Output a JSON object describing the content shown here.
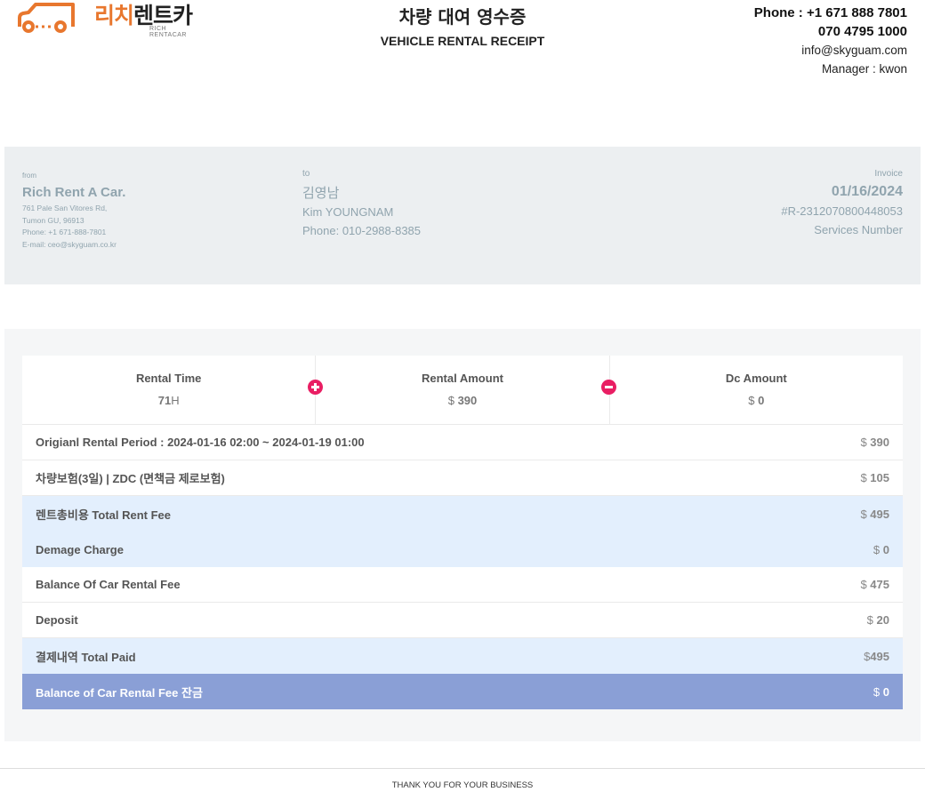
{
  "header": {
    "logo": {
      "korean_part1": "리치",
      "korean_part2": "렌트카",
      "english": "RICH RENTACAR",
      "icon": "car-outline-icon",
      "brand_color": "#e8772e"
    },
    "title_ko": "차량 대여 영수증",
    "title_en": "VEHICLE RENTAL RECEIPT",
    "contact": {
      "phone1": "Phone : +1 671 888 7801",
      "phone2": "070 4795 1000",
      "email": "info@skyguam.com",
      "manager": "Manager : kwon"
    }
  },
  "info": {
    "from": {
      "label": "from",
      "name": "Rich Rent A Car.",
      "address_lines": [
        "761 Pale San Vitores Rd,",
        "Tumon GU, 96913",
        "Phone: +1 671-888-7801",
        "E-mail: ceo@skyguam.co.kr"
      ]
    },
    "to": {
      "label": "to",
      "name_ko": "김영남",
      "name_en": "Kim YOUNGNAM",
      "phone": "Phone: 010-2988-8385"
    },
    "invoice": {
      "label": "Invoice",
      "date": "01/16/2024",
      "number": "#R-2312070800448053",
      "services": "Services Number"
    }
  },
  "summary": {
    "stats": [
      {
        "label": "Rental Time",
        "value": "71",
        "unit": "H"
      },
      {
        "label": "Rental Amount",
        "currency": "$",
        "value": "390"
      },
      {
        "label": "Dc Amount",
        "currency": "$",
        "value": "0"
      }
    ],
    "operators": [
      "plus-circle-icon",
      "minus-circle-icon"
    ],
    "accent_color": "#e91e63",
    "rows": [
      {
        "label": "Origianl Rental Period : 2024-01-16 02:00 ~ 2024-01-19 01:00",
        "currency": "$",
        "amount": "390",
        "style": "white"
      },
      {
        "label": "차량보험(3일) | ZDC (면책금 제로보험)",
        "currency": "$",
        "amount": "105",
        "style": "white"
      },
      {
        "label": "렌트총비용 Total Rent Fee",
        "currency": "$",
        "amount": "495",
        "style": "blue"
      },
      {
        "label": "Demage Charge",
        "currency": "$",
        "amount": "0",
        "style": "blue"
      },
      {
        "label": "Balance Of Car Rental Fee",
        "currency": "$",
        "amount": "475",
        "style": "white"
      },
      {
        "label": "Deposit",
        "currency": "$",
        "amount": "20",
        "style": "white"
      },
      {
        "label": "결제내역 Total Paid",
        "currency": "$",
        "amount": "495",
        "style": "blue"
      },
      {
        "label": "Balance of Car Rental Fee 잔금",
        "currency": "$",
        "amount": "0",
        "style": "dark"
      }
    ]
  },
  "footer": {
    "text": "THANK YOU FOR YOUR BUSINESS"
  }
}
